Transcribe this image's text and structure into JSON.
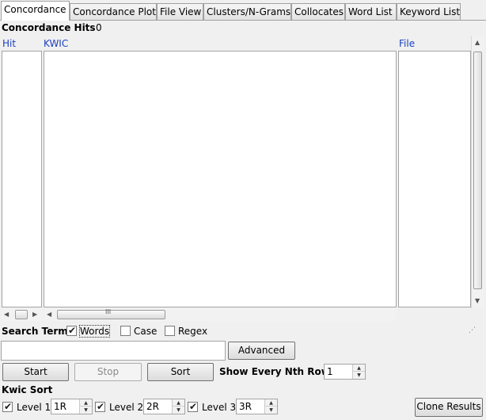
{
  "tabs": [
    {
      "label": "Concordance"
    },
    {
      "label": "Concordance Plot"
    },
    {
      "label": "File View"
    },
    {
      "label": "Clusters/N-Grams"
    },
    {
      "label": "Collocates"
    },
    {
      "label": "Word List"
    },
    {
      "label": "Keyword List"
    }
  ],
  "hits": {
    "label": "Concordance Hits",
    "count": "0"
  },
  "columns": {
    "hit": "Hit",
    "kwic": "KWIC",
    "file": "File"
  },
  "search": {
    "label": "Search Term",
    "words": "Words",
    "case": "Case",
    "regex": "Regex",
    "value": ""
  },
  "buttons": {
    "advanced": "Advanced",
    "start": "Start",
    "stop": "Stop",
    "sort": "Sort",
    "clone": "Clone Results"
  },
  "nth_row": {
    "label": "Show Every Nth Row",
    "value": "1"
  },
  "kwic_sort": {
    "label": "Kwic Sort",
    "levels": [
      {
        "label": "Level 1",
        "value": "1R"
      },
      {
        "label": "Level 2",
        "value": "2R"
      },
      {
        "label": "Level 3",
        "value": "3R"
      }
    ]
  },
  "scrollbar": {
    "grip": "III"
  }
}
